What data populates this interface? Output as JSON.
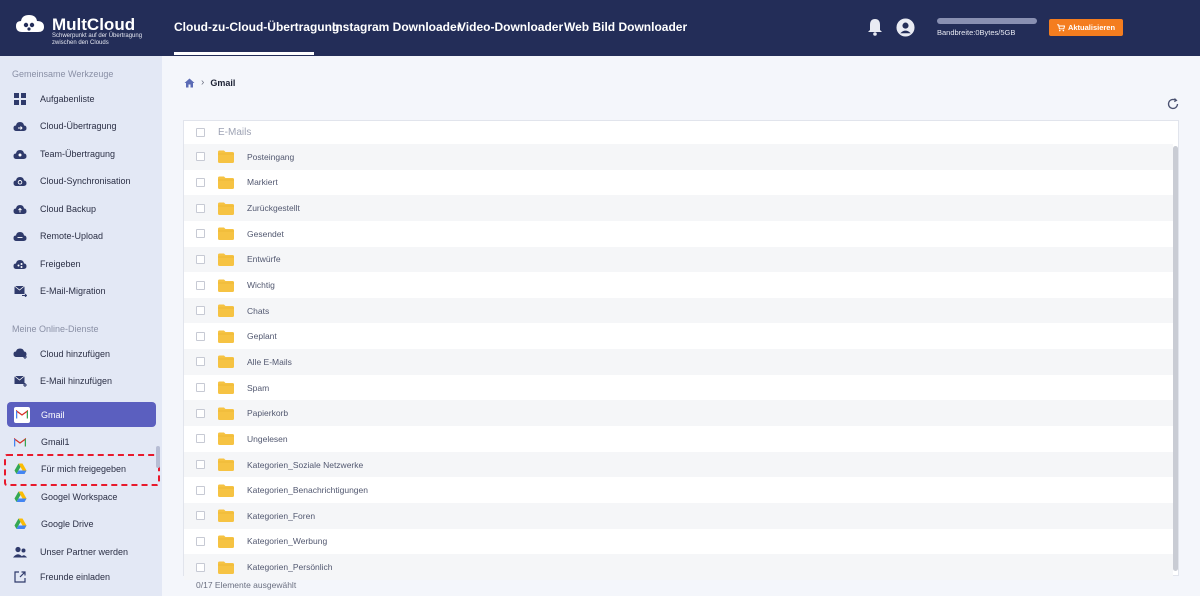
{
  "brand": {
    "name": "MultCloud",
    "tagline": "Schwerpunkt auf der Übertragung zwischen den Clouds"
  },
  "nav": {
    "items": [
      {
        "label": "Cloud-zu-Cloud-Übertragung",
        "active": true
      },
      {
        "label": "Instagram Downloader",
        "active": false
      },
      {
        "label": "Video-Downloader",
        "active": false
      },
      {
        "label": "Web Bild Downloader",
        "active": false
      }
    ]
  },
  "header": {
    "bandwidth_text": "Bandbreite:0Bytes/5GB",
    "bandwidth_used_fraction": 0,
    "upgrade_label": "Aktualisieren"
  },
  "sidebar": {
    "section1_title": "Gemeinsame Werkzeuge",
    "tools": [
      {
        "label": "Aufgabenliste",
        "icon": "grid-icon"
      },
      {
        "label": "Cloud-Übertragung",
        "icon": "cloud-transfer-icon"
      },
      {
        "label": "Team-Übertragung",
        "icon": "team-transfer-icon"
      },
      {
        "label": "Cloud-Synchronisation",
        "icon": "cloud-sync-icon"
      },
      {
        "label": "Cloud Backup",
        "icon": "cloud-backup-icon"
      },
      {
        "label": "Remote-Upload",
        "icon": "remote-upload-icon"
      },
      {
        "label": "Freigeben",
        "icon": "share-icon"
      },
      {
        "label": "E-Mail-Migration",
        "icon": "email-migration-icon"
      }
    ],
    "section2_title": "Meine Online-Dienste",
    "services": [
      {
        "label": "Cloud hinzufügen",
        "icon": "add-cloud-icon"
      },
      {
        "label": "E-Mail hinzufügen",
        "icon": "add-email-icon"
      },
      {
        "label": "Gmail",
        "icon": "gmail-icon",
        "selected": true
      },
      {
        "label": "Gmail1",
        "icon": "gmail-icon"
      },
      {
        "label": "Für mich freigegeben",
        "icon": "google-drive-icon"
      },
      {
        "label": "Googel Workspace",
        "icon": "google-drive-icon"
      },
      {
        "label": "Google Drive",
        "icon": "google-drive-icon"
      },
      {
        "label": "Unser Partner werden",
        "icon": "partner-icon"
      },
      {
        "label": "Freunde einladen",
        "icon": "invite-icon"
      }
    ]
  },
  "breadcrumb": {
    "current": "Gmail"
  },
  "list": {
    "header": "E-Mails",
    "folders": [
      "Posteingang",
      "Markiert",
      "Zurückgestellt",
      "Gesendet",
      "Entwürfe",
      "Wichtig",
      "Chats",
      "Geplant",
      "Alle E-Mails",
      "Spam",
      "Papierkorb",
      "Ungelesen",
      "Kategorien_Soziale Netzwerke",
      "Kategorien_Benachrichtigungen",
      "Kategorien_Foren",
      "Kategorien_Werbung",
      "Kategorien_Persönlich"
    ],
    "status": "0/17 Elemente ausgewählt"
  },
  "colors": {
    "topbar": "#232d58",
    "accent": "#5b5fbf",
    "upgrade": "#f47d1f",
    "folder": "#f6c343",
    "highlight": "#e8192c"
  }
}
